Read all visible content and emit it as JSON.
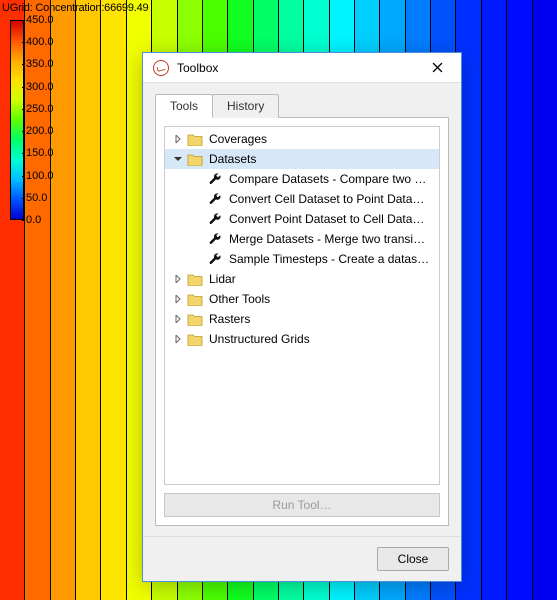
{
  "header_label": "UGrid:  Concentration:66699.49",
  "legend": {
    "ticks": [
      "450.0",
      "400.0",
      "350.0",
      "300.0",
      "250.0",
      "200.0",
      "150.0",
      "100.0",
      "50.0",
      "0.0"
    ]
  },
  "background": {
    "stripe_colors": [
      "#ff2e00",
      "#ff6a00",
      "#ff9a00",
      "#ffc800",
      "#ffe400",
      "#f2ff00",
      "#c8ff00",
      "#8cff00",
      "#4aff00",
      "#10ff20",
      "#00ff66",
      "#00ffa0",
      "#00ffd0",
      "#00f4ff",
      "#00ceff",
      "#00a8ff",
      "#007dff",
      "#0052ff",
      "#0030ff",
      "#001aff",
      "#000cff",
      "#0000f0"
    ]
  },
  "dialog": {
    "title": "Toolbox",
    "tabs": {
      "tools": "Tools",
      "history": "History"
    },
    "run_tool": "Run Tool…",
    "close": "Close"
  },
  "tree": {
    "items": [
      {
        "depth": 0,
        "arrow": "right",
        "icon": "folder",
        "label": "Coverages",
        "selected": false
      },
      {
        "depth": 0,
        "arrow": "down",
        "icon": "folder",
        "label": "Datasets",
        "selected": true
      },
      {
        "depth": 1,
        "arrow": "blank",
        "icon": "tool",
        "label": "Compare Datasets - Compare two …"
      },
      {
        "depth": 1,
        "arrow": "blank",
        "icon": "tool",
        "label": "Convert Cell Dataset to Point Data…"
      },
      {
        "depth": 1,
        "arrow": "blank",
        "icon": "tool",
        "label": "Convert Point Dataset to Cell Data…"
      },
      {
        "depth": 1,
        "arrow": "blank",
        "icon": "tool",
        "label": "Merge Datasets - Merge two transi…"
      },
      {
        "depth": 1,
        "arrow": "blank",
        "icon": "tool",
        "label": "Sample Timesteps - Create a datas…"
      },
      {
        "depth": 0,
        "arrow": "right",
        "icon": "folder",
        "label": "Lidar"
      },
      {
        "depth": 0,
        "arrow": "right",
        "icon": "folder",
        "label": "Other Tools"
      },
      {
        "depth": 0,
        "arrow": "right",
        "icon": "folder",
        "label": "Rasters"
      },
      {
        "depth": 0,
        "arrow": "right",
        "icon": "folder",
        "label": "Unstructured Grids"
      }
    ]
  }
}
